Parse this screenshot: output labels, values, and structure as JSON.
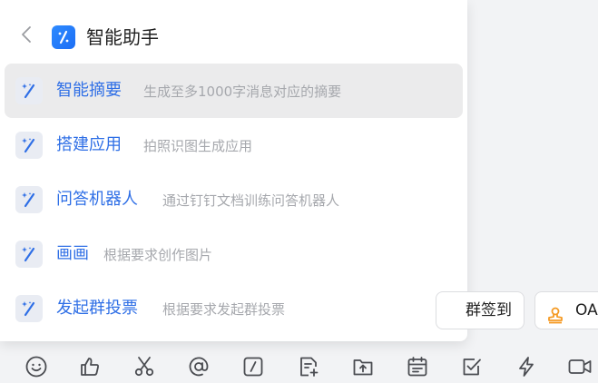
{
  "panel": {
    "title": "智能助手",
    "items": [
      {
        "name": "智能摘要",
        "desc": "生成至多1000字消息对应的摘要"
      },
      {
        "name": "搭建应用",
        "desc": "拍照识图生成应用"
      },
      {
        "name": "问答机器人",
        "desc": "通过钉钉文档训练问答机器人"
      },
      {
        "name": "画画",
        "desc": "根据要求创作图片"
      },
      {
        "name": "发起群投票",
        "desc": "根据要求发起群投票"
      }
    ]
  },
  "chips": {
    "checkin": "群签到",
    "oa": "OA"
  },
  "toolbar": {
    "icons": [
      "emoji-icon",
      "thumbs-up-icon",
      "scissors-icon",
      "at-icon",
      "slash-command-icon",
      "new-doc-icon",
      "upload-folder-icon",
      "calendar-icon",
      "task-check-icon",
      "lightning-icon",
      "video-icon"
    ]
  },
  "colors": {
    "accent": "#2f6fe6",
    "muted": "#a6a8ad",
    "background": "#f2f3f5",
    "oa_orange": "#f59a23"
  }
}
